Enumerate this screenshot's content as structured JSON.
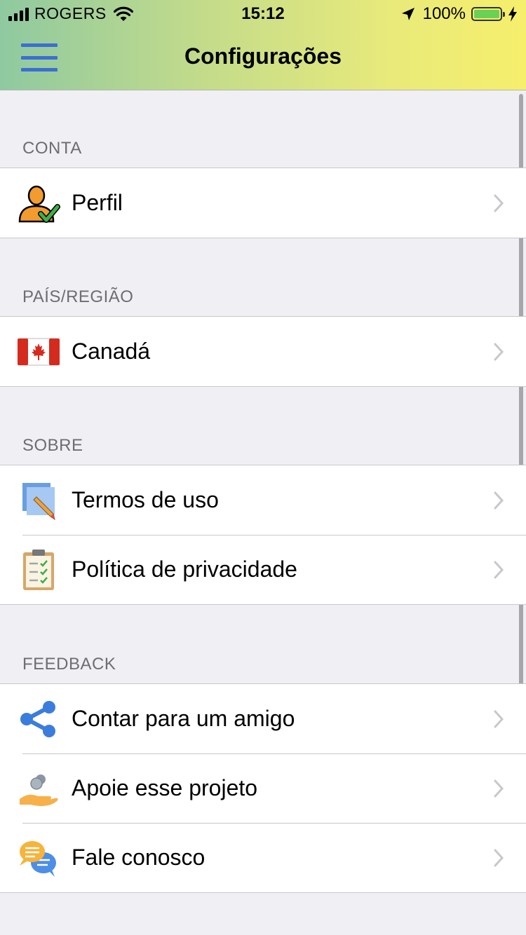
{
  "status_bar": {
    "carrier": "ROGERS",
    "time": "15:12",
    "battery": "100%"
  },
  "header": {
    "title": "Configurações"
  },
  "sections": [
    {
      "title": "CONTA",
      "items": [
        {
          "label": "Perfil",
          "icon": "profile-icon"
        }
      ]
    },
    {
      "title": "PAÍS/REGIÃO",
      "items": [
        {
          "label": "Canadá",
          "icon": "canada-flag-icon"
        }
      ]
    },
    {
      "title": "SOBRE",
      "items": [
        {
          "label": "Termos de uso",
          "icon": "terms-icon"
        },
        {
          "label": "Política de privacidade",
          "icon": "clipboard-icon"
        }
      ]
    },
    {
      "title": "FEEDBACK",
      "items": [
        {
          "label": "Contar para um amigo",
          "icon": "share-icon"
        },
        {
          "label": "Apoie esse projeto",
          "icon": "donate-icon"
        },
        {
          "label": "Fale conosco",
          "icon": "chat-icon"
        }
      ]
    }
  ],
  "colors": {
    "accent": "#3b6fd4",
    "header_gradient_start": "#8fc9a0",
    "header_gradient_end": "#f6ef6c",
    "background": "#efeff4",
    "section_text": "#6d6d72"
  }
}
